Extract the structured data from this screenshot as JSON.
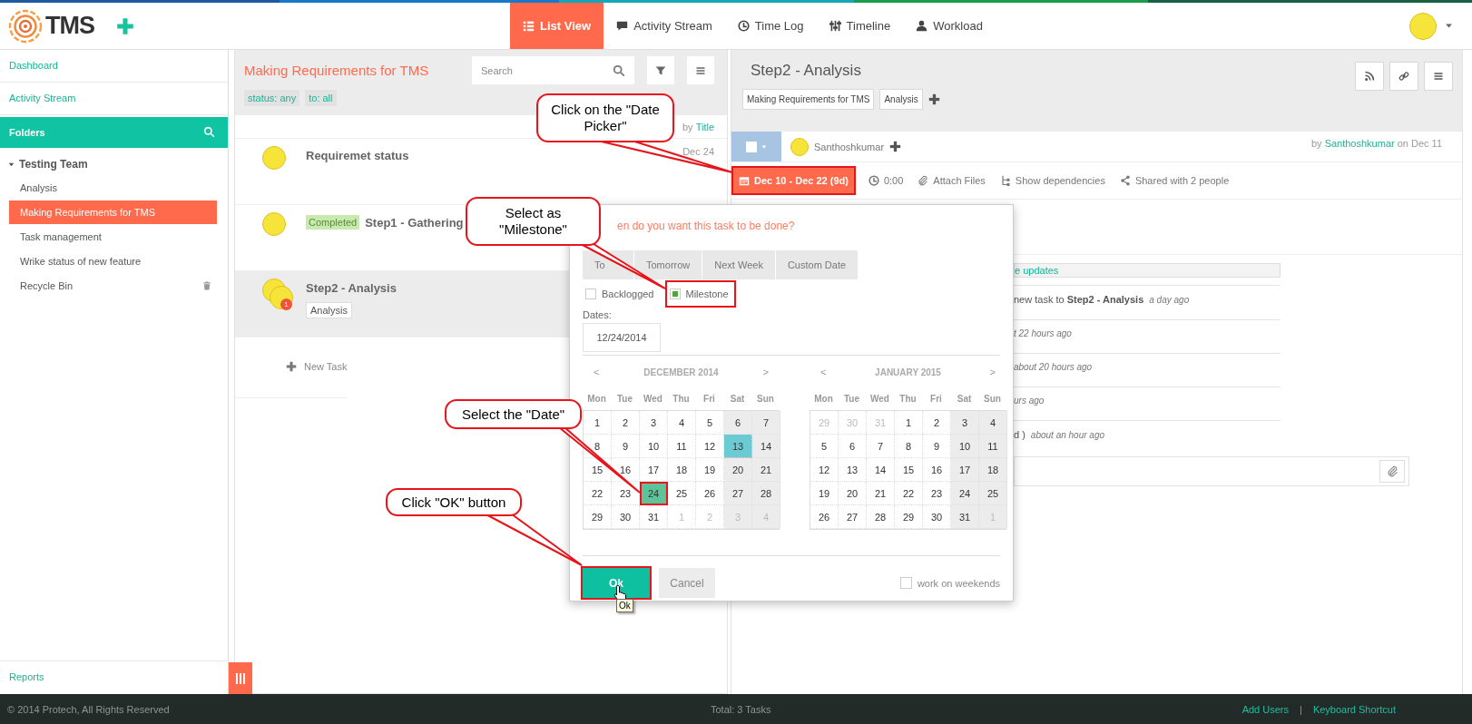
{
  "top_bar": {
    "logo_text": "TMS",
    "nav_tabs": [
      {
        "label": "List View",
        "selected": true
      },
      {
        "label": "Activity Stream",
        "selected": false
      },
      {
        "label": "Time Log",
        "selected": false
      },
      {
        "label": "Timeline",
        "selected": false
      },
      {
        "label": "Workload",
        "selected": false
      }
    ]
  },
  "sidebar": {
    "items": [
      "Dashboard",
      "Activity Stream"
    ],
    "folders_title": "Folders",
    "tree": [
      {
        "label": "Testing Team",
        "expanded": true,
        "selected": false,
        "children": [
          {
            "label": "Analysis",
            "selected": false
          },
          {
            "label": "Making Requirements for TMS",
            "selected": true
          },
          {
            "label": "Task management",
            "selected": false
          },
          {
            "label": "Wrike status of new feature",
            "selected": false
          }
        ]
      }
    ],
    "recycle_bin": "Recycle Bin",
    "reports": "Reports"
  },
  "task_list": {
    "title": "Making Requirements for TMS",
    "search": {
      "placeholder": "Search"
    },
    "filters": [
      "status: any",
      "to: all"
    ],
    "sort": {
      "prefix": "by",
      "field": "Title"
    },
    "tasks": [
      {
        "title": "Requiremet status",
        "date": "Dec 24",
        "selected": false
      },
      {
        "title": "Step1 - Gathering",
        "status": "Completed",
        "selected": false
      },
      {
        "title": "Step2 - Analysis",
        "tags": [
          "Analysis"
        ],
        "badge": "1",
        "selected": true
      }
    ],
    "new_task": "New Task"
  },
  "task_detail": {
    "title": "Step2 - Analysis",
    "tags": [
      "Making Requirements for TMS",
      "Analysis"
    ],
    "assignee": "Santhoshkumar",
    "author_prefix": "by",
    "author": "Santhoshkumar",
    "author_suffix": "on Dec 11",
    "toolbar": [
      {
        "kind": "dates",
        "label": "Dec 10 - Dec 22 (9d)",
        "highlighted": true
      },
      {
        "kind": "time",
        "label": "0:00",
        "highlighted": false
      },
      {
        "kind": "attach",
        "label": "Attach Files",
        "highlighted": false
      },
      {
        "kind": "dependencies",
        "label": "Show dependencies",
        "highlighted": false
      },
      {
        "kind": "share",
        "label": "Shared with 2 people",
        "highlighted": false
      }
    ],
    "feed": [
      {
        "kind": "link",
        "text": "e updates"
      },
      {
        "kind": "entry",
        "text": "new task to **Step2 - Analysis**",
        "time": "a day ago"
      },
      {
        "kind": "entry",
        "time": "t 22 hours ago"
      },
      {
        "kind": "entry",
        "time": "about 20 hours ago"
      },
      {
        "kind": "entry",
        "time": "urs ago"
      },
      {
        "kind": "entry",
        "text": "d )",
        "time": "about an hour ago"
      }
    ]
  },
  "date_picker": {
    "question": "en do you want this task to be done?",
    "quick_tabs": [
      {
        "label": "To",
        "selected": false
      },
      {
        "label": "Tomorrow",
        "selected": false
      },
      {
        "label": "Next Week",
        "selected": false
      },
      {
        "label": "Custom Date",
        "selected": false
      }
    ],
    "options": [
      {
        "label": "Backlogged",
        "checked": false,
        "highlighted": false
      },
      {
        "label": "Milestone",
        "checked": true,
        "highlighted": true
      }
    ],
    "dates_label": "Dates:",
    "date_value": "12/24/2014",
    "months": [
      {
        "title": "DECEMBER 2014",
        "prev": "<",
        "next": ">",
        "weekdays": [
          "Mon",
          "Tue",
          "Wed",
          "Thu",
          "Fri",
          "Sat",
          "Sun"
        ],
        "days": [
          {
            "day": "1",
            "muted": false,
            "today": false,
            "selected": false
          },
          {
            "day": "2",
            "muted": false,
            "today": false,
            "selected": false
          },
          {
            "day": "3",
            "muted": false,
            "today": false,
            "selected": false
          },
          {
            "day": "4",
            "muted": false,
            "today": false,
            "selected": false
          },
          {
            "day": "5",
            "muted": false,
            "today": false,
            "selected": false
          },
          {
            "day": "6",
            "muted": false,
            "today": false,
            "selected": false
          },
          {
            "day": "7",
            "muted": false,
            "today": false,
            "selected": false
          },
          {
            "day": "8",
            "muted": false,
            "today": false,
            "selected": false
          },
          {
            "day": "9",
            "muted": false,
            "today": false,
            "selected": false
          },
          {
            "day": "10",
            "muted": false,
            "today": false,
            "selected": false
          },
          {
            "day": "11",
            "muted": false,
            "today": false,
            "selected": false
          },
          {
            "day": "12",
            "muted": false,
            "today": false,
            "selected": false
          },
          {
            "day": "13",
            "muted": false,
            "today": true,
            "selected": false
          },
          {
            "day": "14",
            "muted": false,
            "today": false,
            "selected": false
          },
          {
            "day": "15",
            "muted": false,
            "today": false,
            "selected": false
          },
          {
            "day": "16",
            "muted": false,
            "today": false,
            "selected": false
          },
          {
            "day": "17",
            "muted": false,
            "today": false,
            "selected": false
          },
          {
            "day": "18",
            "muted": false,
            "today": false,
            "selected": false
          },
          {
            "day": "19",
            "muted": false,
            "today": false,
            "selected": false
          },
          {
            "day": "20",
            "muted": false,
            "today": false,
            "selected": false
          },
          {
            "day": "21",
            "muted": false,
            "today": false,
            "selected": false
          },
          {
            "day": "22",
            "muted": false,
            "today": false,
            "selected": false
          },
          {
            "day": "23",
            "muted": false,
            "today": false,
            "selected": false
          },
          {
            "day": "24",
            "muted": false,
            "today": false,
            "selected": true
          },
          {
            "day": "25",
            "muted": false,
            "today": false,
            "selected": false
          },
          {
            "day": "26",
            "muted": false,
            "today": false,
            "selected": false
          },
          {
            "day": "27",
            "muted": false,
            "today": false,
            "selected": false
          },
          {
            "day": "28",
            "muted": false,
            "today": false,
            "selected": false
          },
          {
            "day": "29",
            "muted": false,
            "today": false,
            "selected": false
          },
          {
            "day": "30",
            "muted": false,
            "today": false,
            "selected": false
          },
          {
            "day": "31",
            "muted": false,
            "today": false,
            "selected": false
          },
          {
            "day": "1",
            "muted": true,
            "today": false,
            "selected": false
          },
          {
            "day": "2",
            "muted": true,
            "today": false,
            "selected": false
          },
          {
            "day": "3",
            "muted": true,
            "today": false,
            "selected": false
          },
          {
            "day": "4",
            "muted": true,
            "today": false,
            "selected": false
          }
        ]
      },
      {
        "title": "JANUARY 2015",
        "prev": "<",
        "next": ">",
        "weekdays": [
          "Mon",
          "Tue",
          "Wed",
          "Thu",
          "Fri",
          "Sat",
          "Sun"
        ],
        "days": [
          {
            "day": "29",
            "muted": true,
            "today": false,
            "selected": false
          },
          {
            "day": "30",
            "muted": true,
            "today": false,
            "selected": false
          },
          {
            "day": "31",
            "muted": true,
            "today": false,
            "selected": false
          },
          {
            "day": "1",
            "muted": false,
            "today": false,
            "selected": false
          },
          {
            "day": "2",
            "muted": false,
            "today": false,
            "selected": false
          },
          {
            "day": "3",
            "muted": false,
            "today": false,
            "selected": false
          },
          {
            "day": "4",
            "muted": false,
            "today": false,
            "selected": false
          },
          {
            "day": "5",
            "muted": false,
            "today": false,
            "selected": false
          },
          {
            "day": "6",
            "muted": false,
            "today": false,
            "selected": false
          },
          {
            "day": "7",
            "muted": false,
            "today": false,
            "selected": false
          },
          {
            "day": "8",
            "muted": false,
            "today": false,
            "selected": false
          },
          {
            "day": "9",
            "muted": false,
            "today": false,
            "selected": false
          },
          {
            "day": "10",
            "muted": false,
            "today": false,
            "selected": false
          },
          {
            "day": "11",
            "muted": false,
            "today": false,
            "selected": false
          },
          {
            "day": "12",
            "muted": false,
            "today": false,
            "selected": false
          },
          {
            "day": "13",
            "muted": false,
            "today": false,
            "selected": false
          },
          {
            "day": "14",
            "muted": false,
            "today": false,
            "selected": false
          },
          {
            "day": "15",
            "muted": false,
            "today": false,
            "selected": false
          },
          {
            "day": "16",
            "muted": false,
            "today": false,
            "selected": false
          },
          {
            "day": "17",
            "muted": false,
            "today": false,
            "selected": false
          },
          {
            "day": "18",
            "muted": false,
            "today": false,
            "selected": false
          },
          {
            "day": "19",
            "muted": false,
            "today": false,
            "selected": false
          },
          {
            "day": "20",
            "muted": false,
            "today": false,
            "selected": false
          },
          {
            "day": "21",
            "muted": false,
            "today": false,
            "selected": false
          },
          {
            "day": "22",
            "muted": false,
            "today": false,
            "selected": false
          },
          {
            "day": "23",
            "muted": false,
            "today": false,
            "selected": false
          },
          {
            "day": "24",
            "muted": false,
            "today": false,
            "selected": false
          },
          {
            "day": "25",
            "muted": false,
            "today": false,
            "selected": false
          },
          {
            "day": "26",
            "muted": false,
            "today": false,
            "selected": false
          },
          {
            "day": "27",
            "muted": false,
            "today": false,
            "selected": false
          },
          {
            "day": "28",
            "muted": false,
            "today": false,
            "selected": false
          },
          {
            "day": "29",
            "muted": false,
            "today": false,
            "selected": false
          },
          {
            "day": "30",
            "muted": false,
            "today": false,
            "selected": false
          },
          {
            "day": "31",
            "muted": false,
            "today": false,
            "selected": false
          },
          {
            "day": "1",
            "muted": true,
            "today": false,
            "selected": false
          }
        ]
      }
    ],
    "ok": {
      "label": "Ok",
      "highlighted": true
    },
    "cancel": "Cancel",
    "weekends": {
      "label": "work on weekends",
      "checked": false
    },
    "tooltip": "Ok"
  },
  "annotations": [
    {
      "text": "Click on the \"Date Picker\""
    },
    {
      "text": "Select as \"Milestone\""
    },
    {
      "text": "Select the \"Date\""
    },
    {
      "text": "Click \"OK\" button"
    }
  ],
  "footer": {
    "copyright": "© 2014 Protech, All Rights Reserved",
    "total": "Total: 3 Tasks",
    "links": [
      "Add Users",
      "Keyboard Shortcut"
    ],
    "separator": "|"
  }
}
